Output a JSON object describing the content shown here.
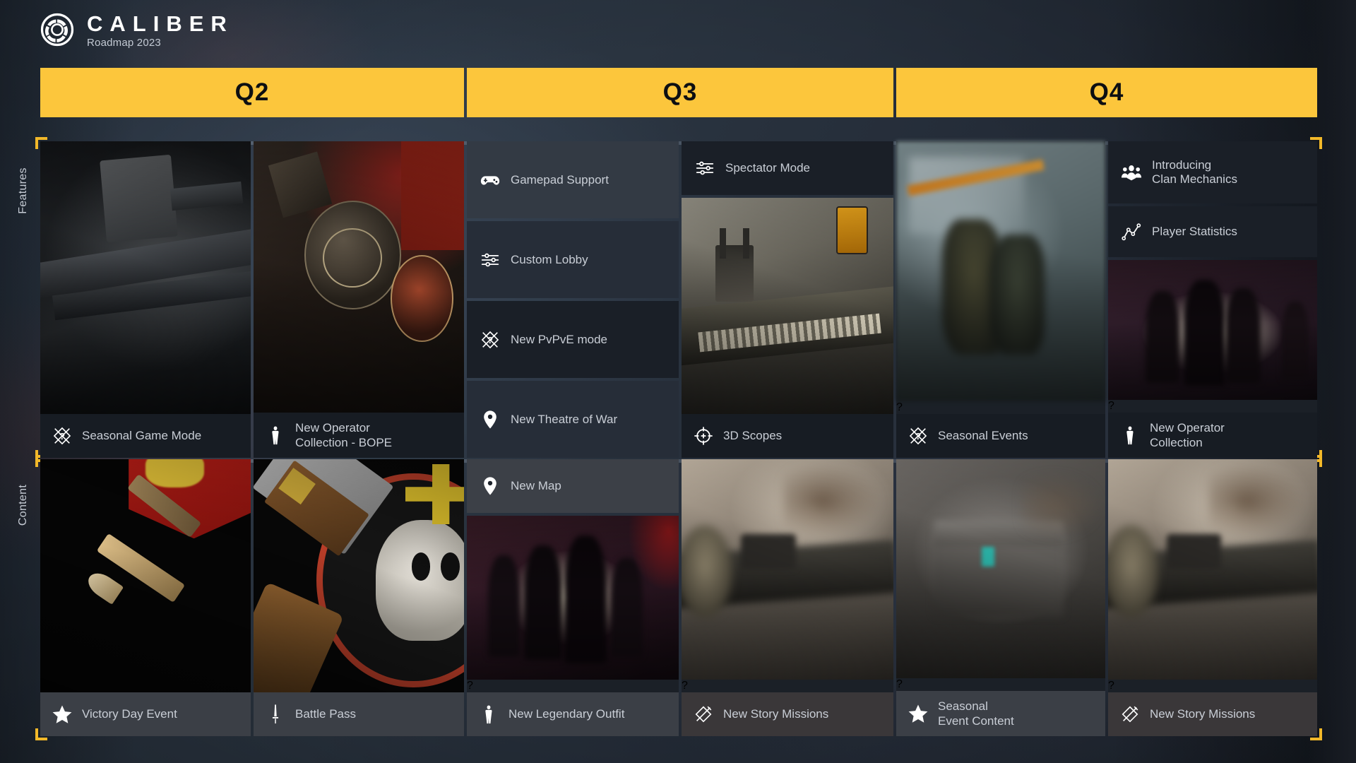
{
  "brand": {
    "name": "CALIBER",
    "subtitle": "Roadmap 2023",
    "logo_icon": "aperture-logo-icon",
    "accent_yellow": "#fcc63c",
    "background": "#2b3644"
  },
  "rails": {
    "features": "Features",
    "content": "Content"
  },
  "quarters": [
    {
      "id": "q2",
      "label": "Q2"
    },
    {
      "id": "q3",
      "label": "Q3"
    },
    {
      "id": "q4",
      "label": "Q4"
    }
  ],
  "features": {
    "q2": [
      {
        "label": "Seasonal Game Mode",
        "icon": "diamond-question-swords-icon",
        "kind": "media",
        "art": "machine-gun"
      },
      {
        "label": "New Operator\nCollection - BOPE",
        "icon": "operator-silhouette-icon",
        "kind": "media",
        "art": "bope-patch"
      }
    ],
    "q3": [
      {
        "label": "Gamepad Support",
        "icon": "gamepad-icon",
        "kind": "chip"
      },
      {
        "label": "Custom Lobby",
        "icon": "sliders-icon",
        "kind": "chip"
      },
      {
        "label": "New PvPvE mode",
        "icon": "diamond-question-swords-icon",
        "kind": "chip"
      },
      {
        "label": "New Theatre of War",
        "icon": "map-pin-icon",
        "kind": "chip"
      },
      {
        "label": "Spectator Mode",
        "icon": "sliders-icon",
        "kind": "chip"
      },
      {
        "label": "3D Scopes",
        "icon": "crosshair-icon",
        "kind": "media",
        "art": "scope-rail"
      }
    ],
    "q4": [
      {
        "label": "Seasonal Events",
        "icon": "diamond-question-swords-icon",
        "kind": "media",
        "art": "soldiers-blur",
        "hidden_marker": "?"
      },
      {
        "label": "Introducing\nClan Mechanics",
        "icon": "clan-group-icon",
        "kind": "chip"
      },
      {
        "label": "Player Statistics",
        "icon": "line-chart-icon",
        "kind": "chip"
      },
      {
        "label": "New Operator\nCollection",
        "icon": "operator-silhouette-icon",
        "kind": "media",
        "art": "squad-silhouette-blur",
        "hidden_marker": "?"
      }
    ]
  },
  "content": {
    "q2": [
      {
        "label": "Victory Day Event",
        "icon": "star-icon",
        "kind": "media",
        "art": "victory-banner"
      },
      {
        "label": "Battle Pass",
        "icon": "sword-icon",
        "kind": "media",
        "art": "skull-patch"
      }
    ],
    "q3": [
      {
        "label": "New Map",
        "icon": "map-pin-icon",
        "kind": "chip"
      },
      {
        "label": "New Legendary Outfit",
        "icon": "operator-silhouette-icon",
        "kind": "media",
        "art": "squad-silhouette-blur",
        "hidden_marker": "?"
      },
      {
        "label": "New Story Missions",
        "icon": "diamond-swords-icon",
        "kind": "media",
        "art": "sniper-blur",
        "hidden_marker": "?"
      }
    ],
    "q4": [
      {
        "label": "Seasonal\nEvent Content",
        "icon": "star-icon",
        "kind": "media",
        "art": "crate-blur",
        "hidden_marker": "?"
      },
      {
        "label": "New Story Missions",
        "icon": "diamond-swords-icon",
        "kind": "media",
        "art": "sniper-blur",
        "hidden_marker": "?"
      }
    ]
  },
  "hidden_marker": "?"
}
